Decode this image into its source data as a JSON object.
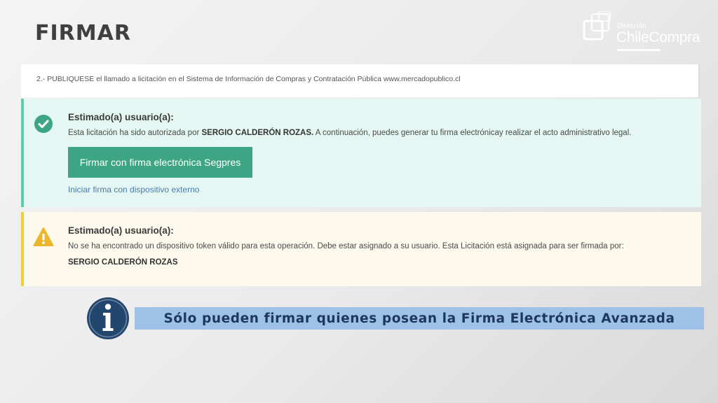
{
  "slide": {
    "title": "FIRMAR"
  },
  "logo": {
    "small_text": "Dirección",
    "brand_text": "ChileCompra"
  },
  "panel_top": {
    "text": "2.- PUBLIQUESE el llamado a licitación en el Sistema de Información de Compras y Contratación Pública www.mercadopublico.cl"
  },
  "success_alert": {
    "heading": "Estimado(a) usuario(a):",
    "body_prefix": "Esta licitación ha sido autorizada por ",
    "authorized_by": "SERGIO CALDERÓN ROZAS.",
    "body_suffix": " A continuación, puedes generar tu firma electrónicay realizar el acto administrativo legal.",
    "sign_button_label": "Firmar con firma electrónica Segpres",
    "external_link_label": "Iniciar firma con dispositivo externo",
    "icon": "check-circle-icon",
    "accent_color": "#5fcbb1"
  },
  "warning_alert": {
    "heading": "Estimado(a) usuario(a):",
    "body": "No se ha encontrado un dispositivo token válido para esta operación. Debe estar asignado a su usuario. Esta Licitación está asignada para ser firmada por:",
    "assigned_to": "SERGIO CALDERÓN ROZAS",
    "icon": "warning-triangle-icon",
    "accent_color": "#f2cf36"
  },
  "info_banner": {
    "text": "Sólo pueden firmar quienes posean la Firma Electrónica Avanzada",
    "icon": "info-icon",
    "background_color": "#9ec1e8"
  }
}
